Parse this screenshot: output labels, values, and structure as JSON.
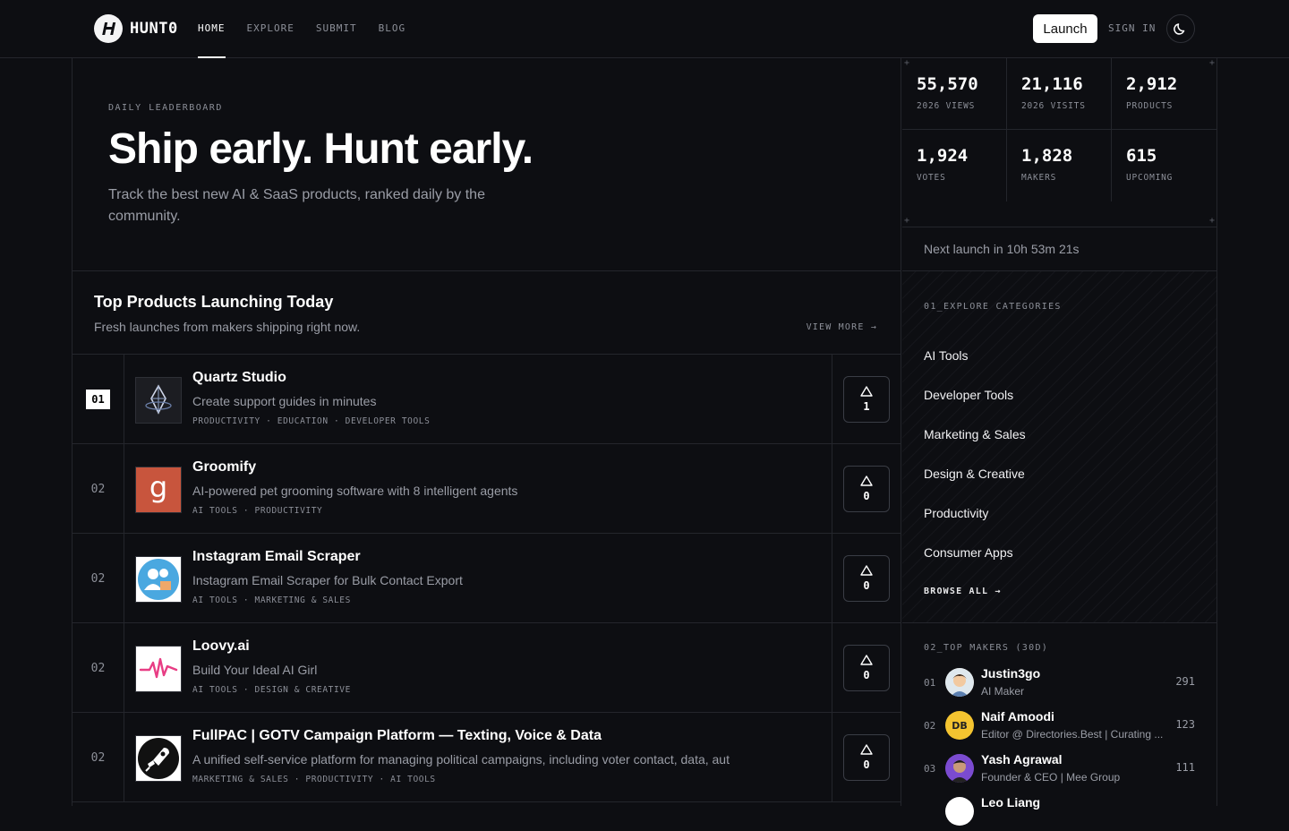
{
  "header": {
    "brand": "HUNT0",
    "nav": [
      {
        "label": "HOME",
        "active": true
      },
      {
        "label": "EXPLORE",
        "active": false
      },
      {
        "label": "SUBMIT",
        "active": false
      },
      {
        "label": "BLOG",
        "active": false
      }
    ],
    "launch_label": "Launch",
    "signin_label": "SIGN IN",
    "theme_icon": "moon-icon"
  },
  "hero": {
    "kicker": "DAILY LEADERBOARD",
    "title": "Ship early. Hunt early.",
    "subtitle": "Track the best new AI & SaaS products, ranked daily by the community."
  },
  "stats": [
    {
      "value": "55,570",
      "label": "2026 VIEWS"
    },
    {
      "value": "21,116",
      "label": "2026 VISITS"
    },
    {
      "value": "2,912",
      "label": "PRODUCTS"
    },
    {
      "value": "1,924",
      "label": "VOTES"
    },
    {
      "value": "1,828",
      "label": "MAKERS"
    },
    {
      "value": "615",
      "label": "UPCOMING"
    }
  ],
  "next_launch": "Next launch in 10h 53m 21s",
  "products_section": {
    "title": "Top Products Launching Today",
    "subtitle": "Fresh launches from makers shipping right now.",
    "view_more": "VIEW MORE →",
    "items": [
      {
        "rank": "01",
        "name": "Quartz Studio",
        "desc": "Create support guides in minutes",
        "tags": "PRODUCTIVITY · EDUCATION · DEVELOPER TOOLS",
        "votes": "1",
        "icon": "quartz-logo-icon"
      },
      {
        "rank": "02",
        "name": "Groomify",
        "desc": "AI-powered pet grooming software with 8 intelligent agents",
        "tags": "AI TOOLS · PRODUCTIVITY",
        "votes": "0",
        "icon": "groomify-logo-icon"
      },
      {
        "rank": "02",
        "name": "Instagram Email Scraper",
        "desc": "Instagram Email Scraper for Bulk Contact Export",
        "tags": "AI TOOLS · MARKETING & SALES",
        "votes": "0",
        "icon": "email-scraper-logo-icon"
      },
      {
        "rank": "02",
        "name": "Loovy.ai",
        "desc": "Build Your Ideal AI Girl",
        "tags": "AI TOOLS · DESIGN & CREATIVE",
        "votes": "0",
        "icon": "loovy-logo-icon"
      },
      {
        "rank": "02",
        "name": "FullPAC | GOTV Campaign Platform — Texting, Voice & Data",
        "desc": "A unified self-service platform for managing political campaigns, including voter contact, data, aut",
        "tags": "MARKETING & SALES · PRODUCTIVITY · AI TOOLS",
        "votes": "0",
        "icon": "fullpac-logo-icon"
      }
    ]
  },
  "categories": {
    "kicker": "01_EXPLORE CATEGORIES",
    "items": [
      "AI Tools",
      "Developer Tools",
      "Marketing & Sales",
      "Design & Creative",
      "Productivity",
      "Consumer Apps"
    ],
    "browse_all": "BROWSE ALL →"
  },
  "makers": {
    "kicker": "02_TOP MAKERS (30D)",
    "items": [
      {
        "rank": "01",
        "name": "Justin3go",
        "role": "AI Maker",
        "score": "291"
      },
      {
        "rank": "02",
        "name": "Naif Amoodi",
        "role": "Editor @ Directories.Best | Curating ...",
        "score": "123",
        "initials": "DB"
      },
      {
        "rank": "03",
        "name": "Yash Agrawal",
        "role": "Founder & CEO | Mee Group",
        "score": "111"
      },
      {
        "rank": "",
        "name": "Leo Liang",
        "role": "",
        "score": ""
      }
    ]
  },
  "colors": {
    "background": "#0d0e12",
    "border": "#24262c",
    "muted": "#8c8f98",
    "loovy_accent": "#e83d84",
    "groomify_bg": "#c8553d",
    "db_badge": "#f4c430"
  }
}
